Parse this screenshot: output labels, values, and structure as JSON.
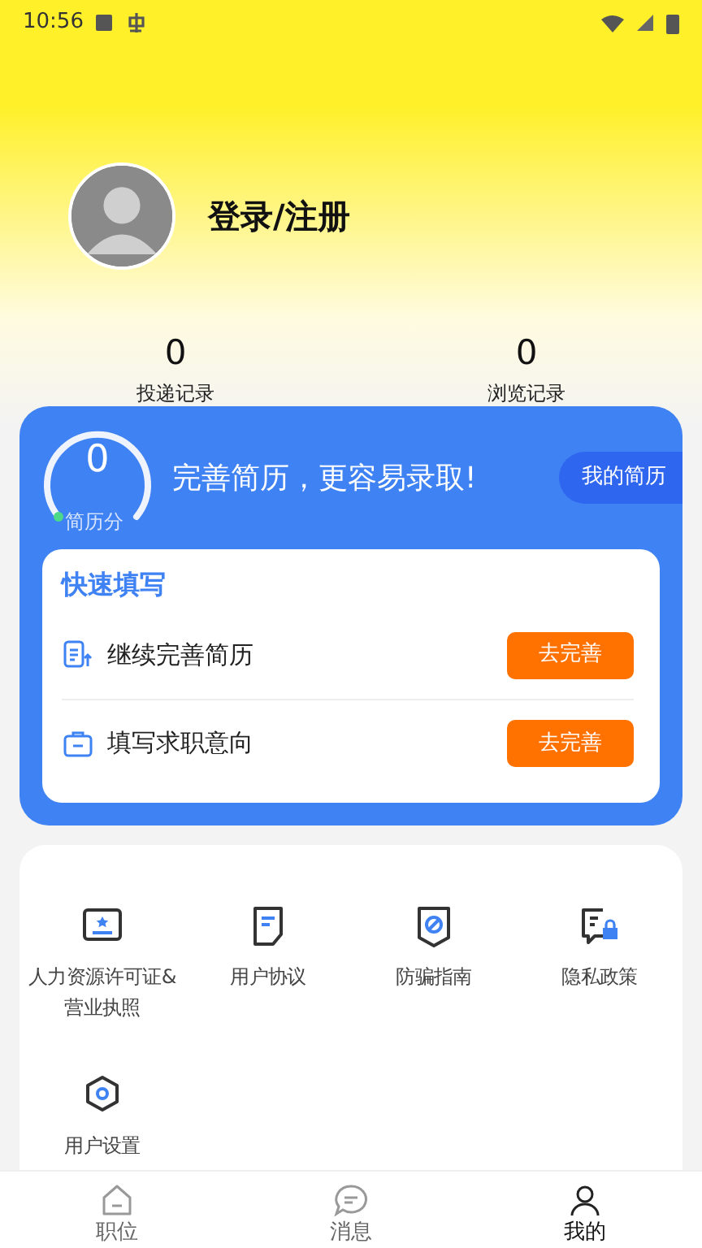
{
  "status_bar": {
    "time": "10:56"
  },
  "profile": {
    "login_label": "登录/注册"
  },
  "stats": [
    {
      "value": "0",
      "label": "投递记录"
    },
    {
      "value": "0",
      "label": "浏览记录"
    }
  ],
  "resume_card": {
    "score": "0",
    "score_label": "简历分",
    "headline": "完善简历，更容易录取!",
    "my_resume_button": "我的简历",
    "quick_fill": {
      "title": "快速填写",
      "items": [
        {
          "kind": "resume",
          "label": "继续完善简历",
          "button": "去完善"
        },
        {
          "kind": "intention",
          "label": "填写求职意向",
          "button": "去完善"
        }
      ]
    }
  },
  "services": [
    {
      "kind": "license",
      "label": "人力资源许可证&营业执照"
    },
    {
      "kind": "agreement",
      "label": "用户协议"
    },
    {
      "kind": "antifraud",
      "label": "防骗指南"
    },
    {
      "kind": "privacy",
      "label": "隐私政策"
    },
    {
      "kind": "settings",
      "label": "用户设置"
    }
  ],
  "bottom_nav": [
    {
      "kind": "jobs",
      "label": "职位",
      "selected": false
    },
    {
      "kind": "messages",
      "label": "消息",
      "selected": false
    },
    {
      "kind": "me",
      "label": "我的",
      "selected": true
    }
  ]
}
